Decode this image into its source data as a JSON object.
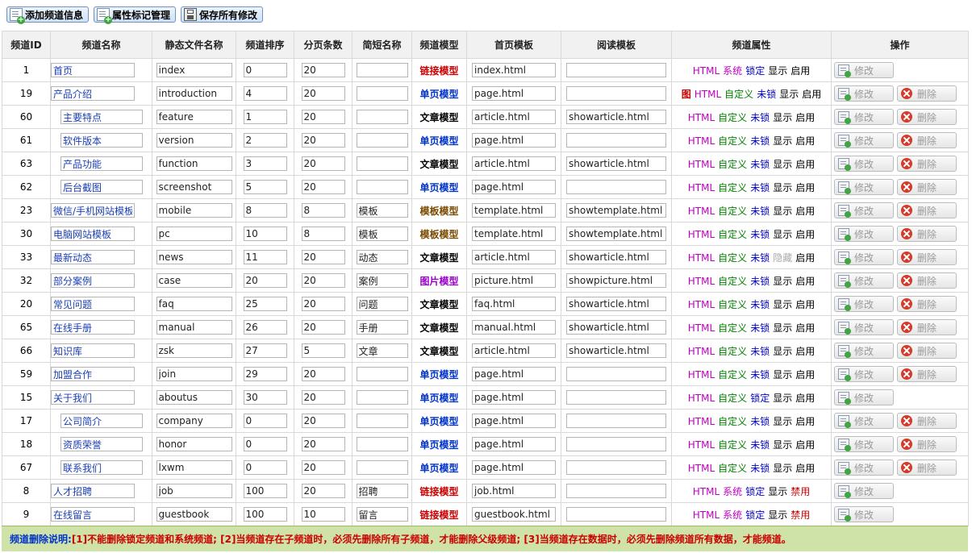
{
  "toolbar": {
    "add_channel": "添加频道信息",
    "attr_manage": "属性标记管理",
    "save_all": "保存所有修改"
  },
  "columns": [
    "频道ID",
    "频道名称",
    "静态文件名称",
    "频道排序",
    "分页条数",
    "简短名称",
    "频道模型",
    "首页模板",
    "阅读模板",
    "频道属性",
    "操作"
  ],
  "labels": {
    "img": "图",
    "html": "HTML",
    "system": "系统",
    "custom": "自定义",
    "locked": "锁定",
    "unlocked": "未锁",
    "show": "显示",
    "hide": "隐藏",
    "enabled": "启用",
    "disabled": "禁用",
    "edit": "修改",
    "delete": "删除"
  },
  "rows": [
    {
      "id": "1",
      "name": "首页",
      "indent": false,
      "file": "index",
      "sort": "0",
      "page": "20",
      "short": "",
      "model": "链接模型",
      "mclass": "link",
      "home": "index.html",
      "read": "",
      "img": false,
      "kind": "system",
      "lock": "locked",
      "vis": "show",
      "state": "enabled",
      "del": false
    },
    {
      "id": "19",
      "name": "产品介绍",
      "indent": false,
      "file": "introduction",
      "sort": "4",
      "page": "20",
      "short": "",
      "model": "单页模型",
      "mclass": "page",
      "home": "page.html",
      "read": "",
      "img": true,
      "kind": "custom",
      "lock": "unlocked",
      "vis": "show",
      "state": "enabled",
      "del": true
    },
    {
      "id": "60",
      "name": "主要特点",
      "indent": true,
      "file": "feature",
      "sort": "1",
      "page": "20",
      "short": "",
      "model": "文章模型",
      "mclass": "article",
      "home": "article.html",
      "read": "showarticle.html",
      "img": false,
      "kind": "custom",
      "lock": "unlocked",
      "vis": "show",
      "state": "enabled",
      "del": true
    },
    {
      "id": "61",
      "name": "软件版本",
      "indent": true,
      "file": "version",
      "sort": "2",
      "page": "20",
      "short": "",
      "model": "单页模型",
      "mclass": "page",
      "home": "page.html",
      "read": "",
      "img": false,
      "kind": "custom",
      "lock": "unlocked",
      "vis": "show",
      "state": "enabled",
      "del": true
    },
    {
      "id": "63",
      "name": "产品功能",
      "indent": true,
      "file": "function",
      "sort": "3",
      "page": "20",
      "short": "",
      "model": "文章模型",
      "mclass": "article",
      "home": "article.html",
      "read": "showarticle.html",
      "img": false,
      "kind": "custom",
      "lock": "unlocked",
      "vis": "show",
      "state": "enabled",
      "del": true
    },
    {
      "id": "62",
      "name": "后台截图",
      "indent": true,
      "file": "screenshot",
      "sort": "5",
      "page": "20",
      "short": "",
      "model": "单页模型",
      "mclass": "page",
      "home": "page.html",
      "read": "",
      "img": false,
      "kind": "custom",
      "lock": "unlocked",
      "vis": "show",
      "state": "enabled",
      "del": true
    },
    {
      "id": "23",
      "name": "微信/手机网站模板",
      "indent": false,
      "file": "mobile",
      "sort": "8",
      "page": "8",
      "short": "模板",
      "model": "模板模型",
      "mclass": "template",
      "home": "template.html",
      "read": "showtemplate.html",
      "img": false,
      "kind": "custom",
      "lock": "unlocked",
      "vis": "show",
      "state": "enabled",
      "del": true
    },
    {
      "id": "30",
      "name": "电脑网站模板",
      "indent": false,
      "file": "pc",
      "sort": "10",
      "page": "8",
      "short": "模板",
      "model": "模板模型",
      "mclass": "template",
      "home": "template.html",
      "read": "showtemplate.html",
      "img": false,
      "kind": "custom",
      "lock": "unlocked",
      "vis": "show",
      "state": "enabled",
      "del": true
    },
    {
      "id": "33",
      "name": "最新动态",
      "indent": false,
      "file": "news",
      "sort": "11",
      "page": "20",
      "short": "动态",
      "model": "文章模型",
      "mclass": "article",
      "home": "article.html",
      "read": "showarticle.html",
      "img": false,
      "kind": "custom",
      "lock": "unlocked",
      "vis": "hide",
      "state": "enabled",
      "del": true
    },
    {
      "id": "32",
      "name": "部分案例",
      "indent": false,
      "file": "case",
      "sort": "20",
      "page": "20",
      "short": "案例",
      "model": "图片模型",
      "mclass": "picture",
      "home": "picture.html",
      "read": "showpicture.html",
      "img": false,
      "kind": "custom",
      "lock": "unlocked",
      "vis": "show",
      "state": "enabled",
      "del": true
    },
    {
      "id": "20",
      "name": "常见问题",
      "indent": false,
      "file": "faq",
      "sort": "25",
      "page": "20",
      "short": "问题",
      "model": "文章模型",
      "mclass": "article",
      "home": "faq.html",
      "read": "showarticle.html",
      "img": false,
      "kind": "custom",
      "lock": "unlocked",
      "vis": "show",
      "state": "enabled",
      "del": true
    },
    {
      "id": "65",
      "name": "在线手册",
      "indent": false,
      "file": "manual",
      "sort": "26",
      "page": "20",
      "short": "手册",
      "model": "文章模型",
      "mclass": "article",
      "home": "manual.html",
      "read": "showarticle.html",
      "img": false,
      "kind": "custom",
      "lock": "unlocked",
      "vis": "show",
      "state": "enabled",
      "del": true
    },
    {
      "id": "66",
      "name": "知识库",
      "indent": false,
      "file": "zsk",
      "sort": "27",
      "page": "5",
      "short": "文章",
      "model": "文章模型",
      "mclass": "article",
      "home": "article.html",
      "read": "showarticle.html",
      "img": false,
      "kind": "custom",
      "lock": "unlocked",
      "vis": "show",
      "state": "enabled",
      "del": true
    },
    {
      "id": "59",
      "name": "加盟合作",
      "indent": false,
      "file": "join",
      "sort": "29",
      "page": "20",
      "short": "",
      "model": "单页模型",
      "mclass": "page",
      "home": "page.html",
      "read": "",
      "img": false,
      "kind": "custom",
      "lock": "unlocked",
      "vis": "show",
      "state": "enabled",
      "del": true
    },
    {
      "id": "15",
      "name": "关于我们",
      "indent": false,
      "file": "aboutus",
      "sort": "30",
      "page": "20",
      "short": "",
      "model": "单页模型",
      "mclass": "page",
      "home": "page.html",
      "read": "",
      "img": false,
      "kind": "custom",
      "lock": "locked",
      "vis": "show",
      "state": "enabled",
      "del": false
    },
    {
      "id": "17",
      "name": "公司简介",
      "indent": true,
      "file": "company",
      "sort": "0",
      "page": "20",
      "short": "",
      "model": "单页模型",
      "mclass": "page",
      "home": "page.html",
      "read": "",
      "img": false,
      "kind": "custom",
      "lock": "unlocked",
      "vis": "show",
      "state": "enabled",
      "del": true
    },
    {
      "id": "18",
      "name": "资质荣誉",
      "indent": true,
      "file": "honor",
      "sort": "0",
      "page": "20",
      "short": "",
      "model": "单页模型",
      "mclass": "page",
      "home": "page.html",
      "read": "",
      "img": false,
      "kind": "custom",
      "lock": "unlocked",
      "vis": "show",
      "state": "enabled",
      "del": true
    },
    {
      "id": "67",
      "name": "联系我们",
      "indent": true,
      "file": "lxwm",
      "sort": "0",
      "page": "20",
      "short": "",
      "model": "单页模型",
      "mclass": "page",
      "home": "page.html",
      "read": "",
      "img": false,
      "kind": "custom",
      "lock": "unlocked",
      "vis": "show",
      "state": "enabled",
      "del": true
    },
    {
      "id": "8",
      "name": "人才招聘",
      "indent": false,
      "file": "job",
      "sort": "100",
      "page": "20",
      "short": "招聘",
      "model": "链接模型",
      "mclass": "link",
      "home": "job.html",
      "read": "",
      "img": false,
      "kind": "system",
      "lock": "locked",
      "vis": "show",
      "state": "disabled",
      "del": false
    },
    {
      "id": "9",
      "name": "在线留言",
      "indent": false,
      "file": "guestbook",
      "sort": "100",
      "page": "10",
      "short": "留言",
      "model": "链接模型",
      "mclass": "link",
      "home": "guestbook.html",
      "read": "",
      "img": false,
      "kind": "system",
      "lock": "locked",
      "vis": "show",
      "state": "disabled",
      "del": false
    }
  ],
  "note": {
    "label": "频道删除说明:",
    "text": "[1]不能删除锁定频道和系统频道; [2]当频道存在子频道时，必须先删除所有子频道，才能删除父级频道; [3]当频道存在数据时，必须先删除频道所有数据，才能频道。"
  }
}
